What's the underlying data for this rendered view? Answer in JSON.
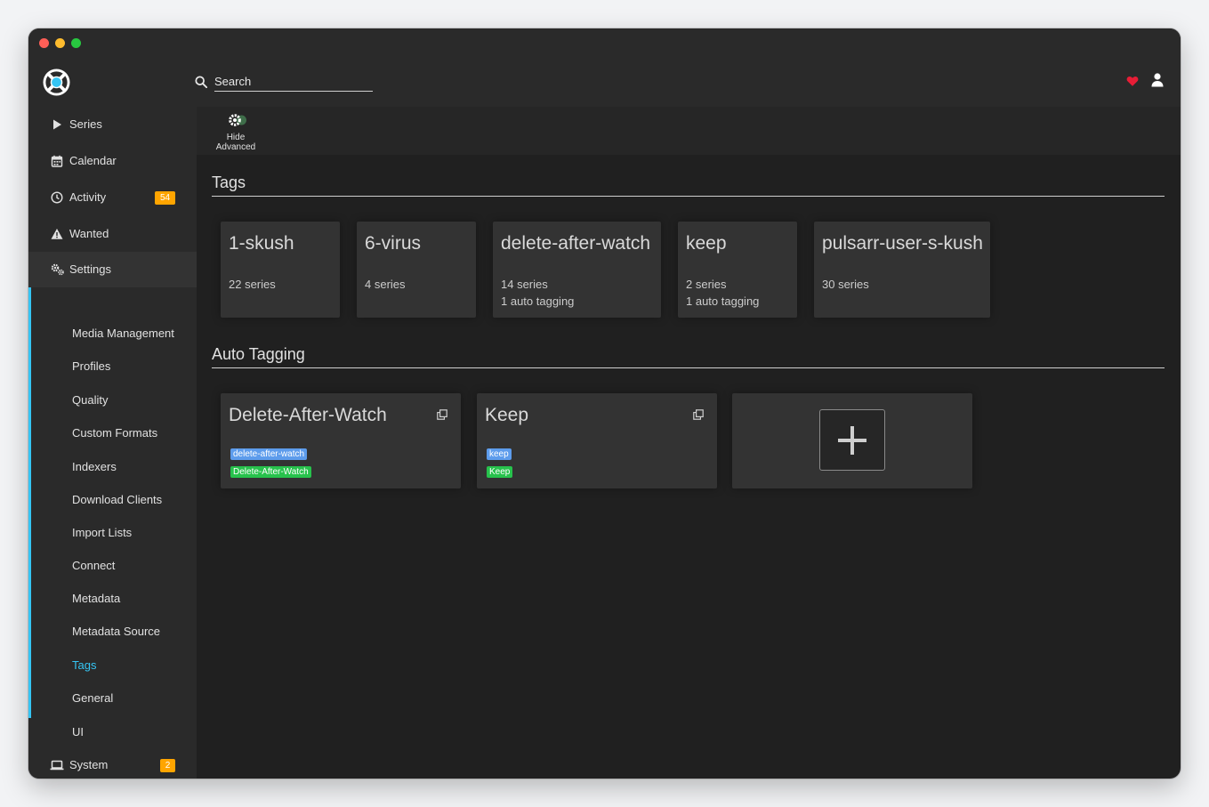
{
  "header": {
    "search_placeholder": "Search",
    "heart_color": "#e71d36",
    "accent_color": "#35c5f4"
  },
  "sidebar": {
    "items": [
      {
        "label": "Series",
        "icon": "play-icon"
      },
      {
        "label": "Calendar",
        "icon": "calendar-icon"
      },
      {
        "label": "Activity",
        "icon": "clock-icon",
        "badge": "54"
      },
      {
        "label": "Wanted",
        "icon": "warning-icon"
      },
      {
        "label": "Settings",
        "icon": "cogs-icon"
      },
      {
        "label": "System",
        "icon": "laptop-icon",
        "badge": "2"
      }
    ],
    "settings_sub": [
      "Media Management",
      "Profiles",
      "Quality",
      "Custom Formats",
      "Indexers",
      "Download Clients",
      "Import Lists",
      "Connect",
      "Metadata",
      "Metadata Source",
      "Tags",
      "General",
      "UI"
    ],
    "active_sub": "Tags"
  },
  "toolbar": {
    "advanced_line1": "Hide",
    "advanced_line2": "Advanced"
  },
  "tags_section": {
    "title": "Tags",
    "tags": [
      {
        "name": "1-skush",
        "count": "22 series",
        "auto": ""
      },
      {
        "name": "6-virus",
        "count": "4 series",
        "auto": ""
      },
      {
        "name": "delete-after-watch",
        "count": "14 series",
        "auto": "1 auto tagging"
      },
      {
        "name": "keep",
        "count": "2 series",
        "auto": "1 auto tagging"
      },
      {
        "name": "pulsarr-user-s-kush",
        "count": "30 series",
        "auto": ""
      }
    ]
  },
  "auto_tagging": {
    "title": "Auto Tagging",
    "items": [
      {
        "name": "Delete-After-Watch",
        "tag": "delete-after-watch",
        "condition": "Delete-After-Watch"
      },
      {
        "name": "Keep",
        "tag": "keep",
        "condition": "Keep"
      }
    ]
  }
}
